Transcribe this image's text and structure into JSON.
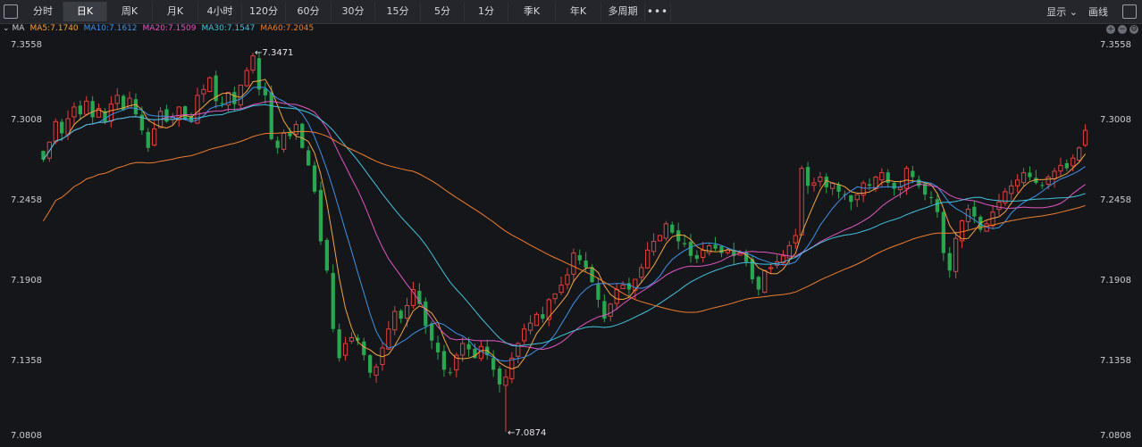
{
  "toolbar": {
    "tabs": [
      "分时",
      "日K",
      "周K",
      "月K",
      "4小时",
      "120分",
      "60分",
      "30分",
      "15分",
      "5分",
      "1分",
      "季K",
      "年K",
      "多周期"
    ],
    "active_tab": "日K",
    "more_label": "•••",
    "display_label": "显示",
    "draw_label": "画线"
  },
  "indicator": {
    "name": "MA",
    "items": [
      {
        "label": "MA5:7.1740",
        "color": "#f2a541"
      },
      {
        "label": "MA10:7.1612",
        "color": "#3f92e8"
      },
      {
        "label": "MA20:7.1509",
        "color": "#e056c1"
      },
      {
        "label": "MA30:7.1547",
        "color": "#43c3df"
      },
      {
        "label": "MA60:7.2045",
        "color": "#ee7d2f"
      }
    ]
  },
  "colors": {
    "up": "#e0413d",
    "down": "#28a750",
    "background": "#151619"
  },
  "chart_data": {
    "type": "candlestick",
    "ylim": [
      7.0808,
      7.3558
    ],
    "y_ticks": [
      "7.3558",
      "7.3008",
      "7.2458",
      "7.1908",
      "7.1358",
      "7.0808"
    ],
    "annotations": {
      "high": "←7.3471",
      "low": "←7.0874",
      "high_value": 7.3471,
      "low_value": 7.0874
    },
    "close_series": [
      7.274,
      7.286,
      7.3,
      7.292,
      7.302,
      7.31,
      7.305,
      7.314,
      7.303,
      7.309,
      7.3,
      7.312,
      7.318,
      7.308,
      7.316,
      7.305,
      7.294,
      7.282,
      7.295,
      7.307,
      7.3,
      7.303,
      7.31,
      7.302,
      7.3,
      7.318,
      7.322,
      7.33,
      7.314,
      7.312,
      7.32,
      7.312,
      7.325,
      7.335,
      7.345,
      7.322,
      7.318,
      7.288,
      7.282,
      7.292,
      7.29,
      7.298,
      7.282,
      7.27,
      7.252,
      7.218,
      7.198,
      7.158,
      7.138,
      7.148,
      7.152,
      7.15,
      7.14,
      7.128,
      7.132,
      7.145,
      7.158,
      7.17,
      7.165,
      7.174,
      7.185,
      7.175,
      7.16,
      7.15,
      7.142,
      7.13,
      7.128,
      7.14,
      7.148,
      7.144,
      7.138,
      7.146,
      7.14,
      7.13,
      7.12,
      7.125,
      7.138,
      7.148,
      7.158,
      7.162,
      7.168,
      7.165,
      7.178,
      7.182,
      7.188,
      7.195,
      7.21,
      7.205,
      7.2,
      7.19,
      7.178,
      7.165,
      7.175,
      7.185,
      7.188,
      7.185,
      7.192,
      7.2,
      7.212,
      7.218,
      7.222,
      7.23,
      7.224,
      7.218,
      7.216,
      7.208,
      7.206,
      7.212,
      7.215,
      7.213,
      7.21,
      7.212,
      7.208,
      7.21,
      7.204,
      7.192,
      7.185,
      7.198,
      7.2,
      7.204,
      7.208,
      7.215,
      7.222,
      7.268,
      7.256,
      7.258,
      7.262,
      7.255,
      7.258,
      7.252,
      7.25,
      7.245,
      7.25,
      7.258,
      7.256,
      7.262,
      7.265,
      7.258,
      7.254,
      7.255,
      7.268,
      7.262,
      7.256,
      7.25,
      7.248,
      7.238,
      7.21,
      7.198,
      7.22,
      7.232,
      7.24,
      7.235,
      7.226,
      7.23,
      7.238,
      7.245,
      7.252,
      7.256,
      7.26,
      7.265,
      7.262,
      7.258,
      7.256,
      7.262,
      7.266,
      7.27,
      7.268,
      7.275,
      7.282,
      7.294
    ]
  }
}
